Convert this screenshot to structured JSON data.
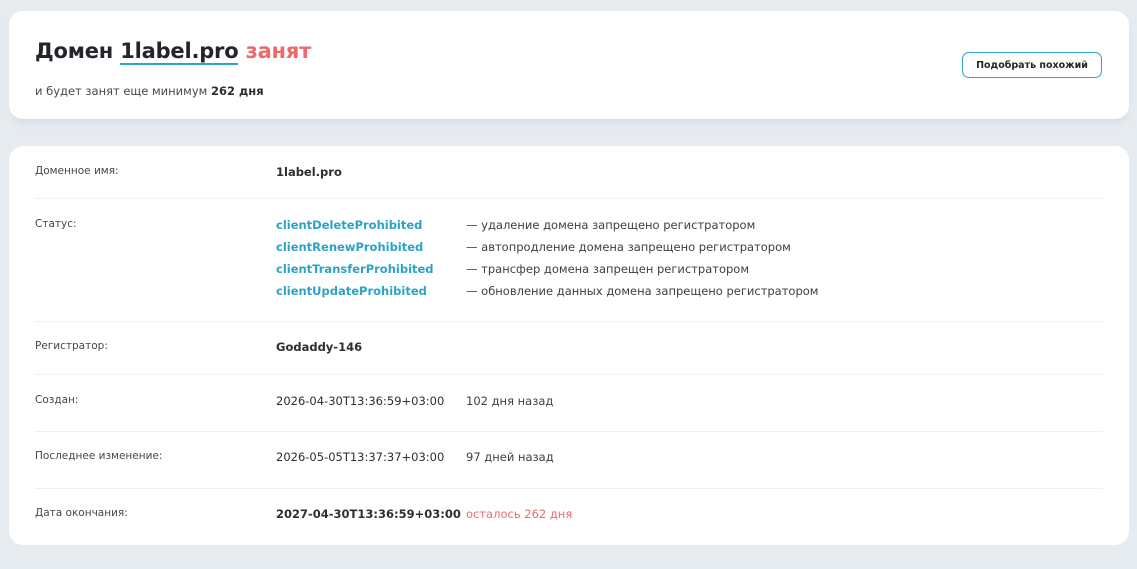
{
  "header": {
    "title_prefix": "Домен",
    "domain": "1label.pro",
    "state": "занят",
    "subtitle_prefix": "и будет занят еще минимум",
    "subtitle_days": "262 дня",
    "similar_button": "Подобрать похожий"
  },
  "details": {
    "domain_name": {
      "label": "Доменное имя:",
      "value": "1label.pro"
    },
    "status": {
      "label": "Статус:",
      "items": [
        {
          "code": "clientDeleteProhibited",
          "desc": "— удаление домена запрещено регистратором"
        },
        {
          "code": "clientRenewProhibited",
          "desc": "— автопродление домена запрещено регистратором"
        },
        {
          "code": "clientTransferProhibited",
          "desc": "— трансфер домена запрещен регистратором"
        },
        {
          "code": "clientUpdateProhibited",
          "desc": "— обновление данных домена запрещено регистратором"
        }
      ]
    },
    "registrar": {
      "label": "Регистратор:",
      "value": "Godaddy-146"
    },
    "created": {
      "label": "Создан:",
      "value": "2026-04-30T13:36:59+03:00",
      "note": "102 дня назад"
    },
    "updated": {
      "label": "Последнее изменение:",
      "value": "2026-05-05T13:37:37+03:00",
      "note": "97 дней назад"
    },
    "expires": {
      "label": "Дата окончания:",
      "value": "2027-04-30T13:36:59+03:00",
      "note": "осталось 262 дня"
    }
  },
  "colors": {
    "accent": "#2aa3c5",
    "busy": "#ee6a6a",
    "background": "#e6ebef",
    "card": "#ffffff"
  }
}
